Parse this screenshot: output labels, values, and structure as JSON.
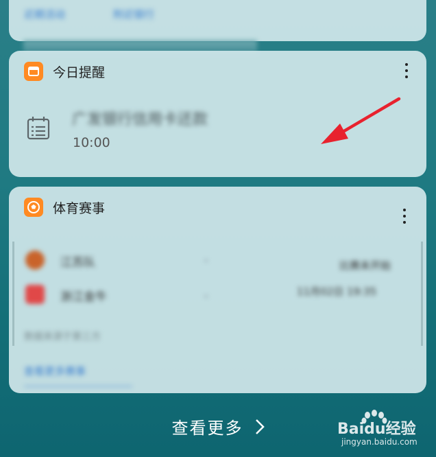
{
  "top_card": {
    "link1": "近期活动",
    "link2": "附近银行"
  },
  "reminder_card": {
    "title": "今日提醒",
    "icon": "calendar-app-icon",
    "accent": "#ff8a22",
    "item_title": "广发银行信用卡还款",
    "item_time": "10:00"
  },
  "sports_card": {
    "title": "体育赛事",
    "icon": "football-app-icon",
    "accent": "#ff8a22",
    "team1": "江苏队",
    "team2": "浙江金牛",
    "score1": "-",
    "score2": "-",
    "match_status": "比赛未开始",
    "match_time": "11月02日 19:35",
    "note": "数据来源于第三方",
    "link": "查看更多赛事"
  },
  "footer": {
    "see_more": "查看更多",
    "chevron": "chevron-right-icon"
  },
  "watermark": {
    "brand": "Baidu经验",
    "url": "jingyan.baidu.com"
  }
}
